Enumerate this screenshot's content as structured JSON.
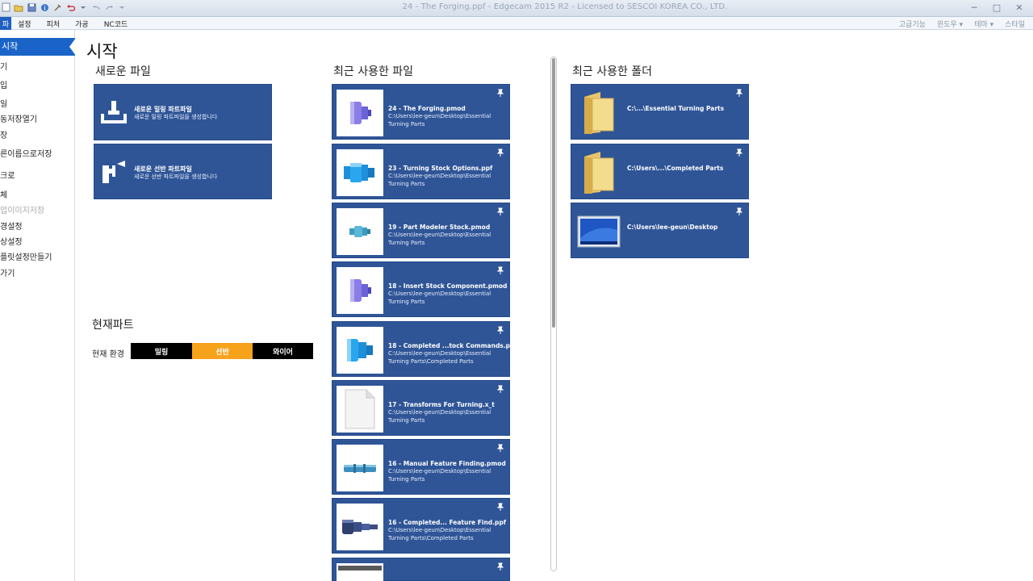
{
  "window": {
    "title": "24 - The Forging.ppf - Edgecam 2015 R2 - Licensed to SESCOI KOREA CO., LTD."
  },
  "menubar": {
    "file_label": "파",
    "items": [
      "설정",
      "피처",
      "가공",
      "NC코드"
    ],
    "right_items": [
      "고급기능",
      "윈도우 ▾",
      "테마 ▾",
      "스타일"
    ]
  },
  "leftnav": {
    "selected": "시작",
    "items": [
      "기",
      "입",
      "일",
      "동저장열기",
      "장",
      "른이름으로저장",
      "크로",
      "체",
      "업이미지저장",
      "경설정",
      "상설정",
      "플릿설정만들기",
      "가기"
    ]
  },
  "page": {
    "title": "시작",
    "new_files_title": "새로운 파일",
    "recent_files_title": "최근 사용한 파일",
    "recent_folders_title": "최근 사용한 폴더",
    "current_part_title": "현재파트"
  },
  "new_files": [
    {
      "title": "새로운 밀링 파트파일",
      "subtitle": "새로운 밀링 파트파일을 생성합니다",
      "icon": "milling-icon"
    },
    {
      "title": "새로운 선반 파트파일",
      "subtitle": "새로운 선반 파트파일을 생성합니다",
      "icon": "turning-icon"
    }
  ],
  "recent_files": [
    {
      "name": "24 - The Forging.pmod",
      "path": "C:\\Users\\lee-geun\\Desktop\\Essential Turning Parts",
      "thumb": "part-violet"
    },
    {
      "name": "23 - Turning Stock Options.ppf",
      "path": "C:\\Users\\lee-geun\\Desktop\\Essential Turning Parts",
      "thumb": "part-blue"
    },
    {
      "name": "19 - Part Modeler Stock.pmod",
      "path": "C:\\Users\\lee-geun\\Desktop\\Essential Turning Parts",
      "thumb": "part-teal-small"
    },
    {
      "name": "18 - Insert Stock Component.pmod",
      "path": "C:\\Users\\lee-geun\\Desktop\\Essential Turning Parts",
      "thumb": "part-violet"
    },
    {
      "name": "18 - Completed ...tock Commands.ppf",
      "path": "C:\\Users\\lee-geun\\Desktop\\Essential Turning Parts\\Completed Parts",
      "thumb": "part-blue"
    },
    {
      "name": "17 - Transforms For Turning.x_t",
      "path": "C:\\Users\\lee-geun\\Desktop\\Essential Turning Parts",
      "thumb": "blank-document"
    },
    {
      "name": "16 - Manual Feature Finding.pmod",
      "path": "C:\\Users\\lee-geun\\Desktop\\Essential Turning Parts",
      "thumb": "part-shaft"
    },
    {
      "name": "16 -  Completed... Feature Find.ppf",
      "path": "C:\\Users\\lee-geun\\Desktop\\Essential Turning Parts\\Completed Parts",
      "thumb": "part-dark"
    }
  ],
  "recent_folders": [
    {
      "name": "C:\\...\\Essential Turning Parts",
      "thumb": "folder"
    },
    {
      "name": "C:\\Users\\...\\Completed Parts",
      "thumb": "folder"
    },
    {
      "name": "C:\\Users\\lee-geun\\Desktop",
      "thumb": "desktop"
    }
  ],
  "environment": {
    "label": "현재 환경",
    "options": [
      {
        "label": "밀링",
        "color": "#000000"
      },
      {
        "label": "선반",
        "color": "#f7a21b"
      },
      {
        "label": "와이어",
        "color": "#000000"
      }
    ]
  },
  "colors": {
    "tile": "#2f5597",
    "nav_selected": "#1a64c9"
  }
}
